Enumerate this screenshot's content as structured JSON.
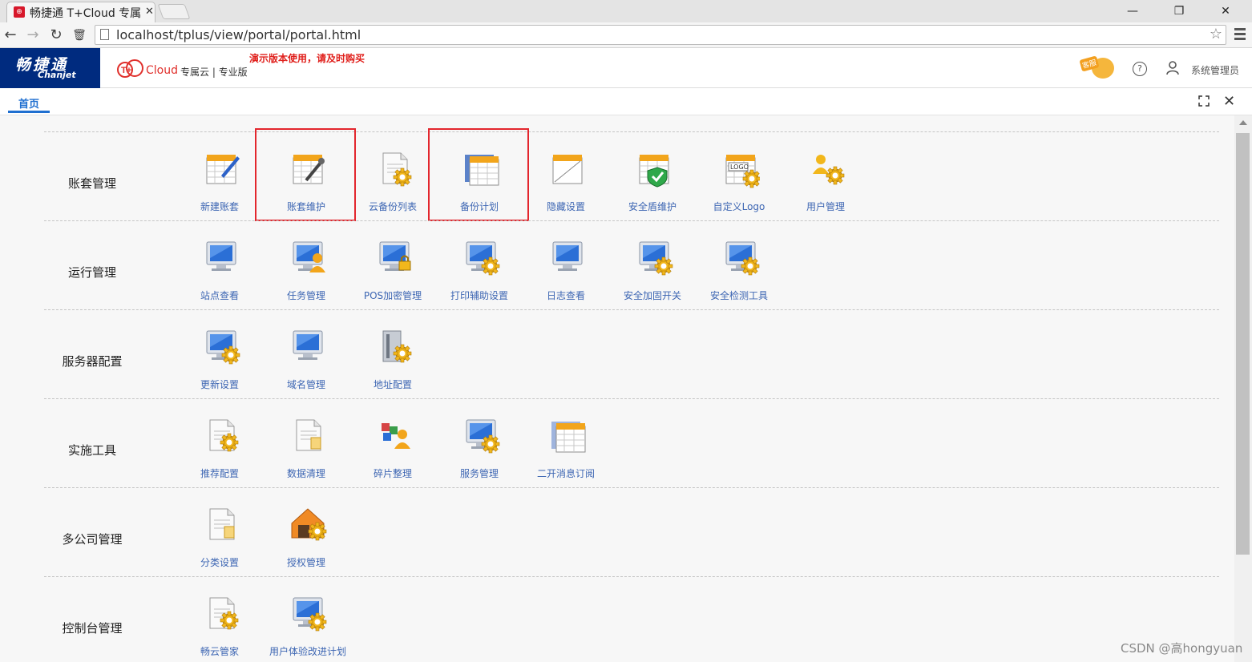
{
  "browser": {
    "tab_title": "畅捷通 T+Cloud 专属",
    "favicon_glyph": "⊕",
    "url": "localhost/tplus/view/portal/portal.html",
    "nav": {
      "back": "←",
      "forward": "→",
      "reload": "↻",
      "delete": "🗑",
      "star": "☆"
    },
    "window": {
      "minimize": "—",
      "maximize": "❐",
      "close": "✕"
    }
  },
  "header": {
    "logo_cn": "畅捷通",
    "logo_en": "Chanjet",
    "cloud_text": "Cloud",
    "edition": "专属云 | 专业版",
    "demo_notice": "演示版本使用，请及时购买",
    "kefu_badge": "客服",
    "help_glyph": "?",
    "user_name": "系统管理员"
  },
  "page_tabs": {
    "home": "首页",
    "close_glyph": "✕"
  },
  "sections": [
    {
      "title": "账套管理",
      "items": [
        {
          "label": "新建账套",
          "icon": "new-account-icon"
        },
        {
          "label": "账套维护",
          "icon": "account-maintain-icon"
        },
        {
          "label": "云备份列表",
          "icon": "cloud-backup-list-icon"
        },
        {
          "label": "备份计划",
          "icon": "backup-plan-icon"
        },
        {
          "label": "隐藏设置",
          "icon": "hide-settings-icon"
        },
        {
          "label": "安全盾维护",
          "icon": "security-shield-icon"
        },
        {
          "label": "自定义Logo",
          "icon": "custom-logo-icon"
        },
        {
          "label": "用户管理",
          "icon": "user-management-icon"
        }
      ]
    },
    {
      "title": "运行管理",
      "items": [
        {
          "label": "站点查看",
          "icon": "monitor-icon"
        },
        {
          "label": "任务管理",
          "icon": "monitor-user-icon"
        },
        {
          "label": "POS加密管理",
          "icon": "monitor-lock-icon"
        },
        {
          "label": "打印辅助设置",
          "icon": "monitor-gear-icon"
        },
        {
          "label": "日志查看",
          "icon": "monitor-icon"
        },
        {
          "label": "安全加固开关",
          "icon": "monitor-gear-icon"
        },
        {
          "label": "安全检测工具",
          "icon": "monitor-gear-icon"
        }
      ]
    },
    {
      "title": "服务器配置",
      "items": [
        {
          "label": "更新设置",
          "icon": "monitor-gear-icon"
        },
        {
          "label": "域名管理",
          "icon": "monitor-icon"
        },
        {
          "label": "地址配置",
          "icon": "server-gear-icon"
        }
      ]
    },
    {
      "title": "实施工具",
      "items": [
        {
          "label": "推荐配置",
          "icon": "document-gear-icon"
        },
        {
          "label": "数据清理",
          "icon": "document-icon"
        },
        {
          "label": "碎片整理",
          "icon": "defrag-user-icon"
        },
        {
          "label": "服务管理",
          "icon": "monitor-gear-icon"
        },
        {
          "label": "二开消息订阅",
          "icon": "calendar-table-icon"
        }
      ]
    },
    {
      "title": "多公司管理",
      "items": [
        {
          "label": "分类设置",
          "icon": "document-icon"
        },
        {
          "label": "授权管理",
          "icon": "house-gear-icon"
        }
      ]
    },
    {
      "title": "控制台管理",
      "items": [
        {
          "label": "畅云管家",
          "icon": "document-gear-icon"
        },
        {
          "label": "用户体验改进计划",
          "icon": "monitor-gear-icon"
        }
      ]
    }
  ],
  "highlighted": [
    "账套维护",
    "备份计划"
  ],
  "watermark": "CSDN @高hongyuan",
  "colors": {
    "brand_blue": "#002b7f",
    "link_blue": "#3d66b3",
    "highlight_red": "#e3262d",
    "notice_red": "#e0201c"
  }
}
